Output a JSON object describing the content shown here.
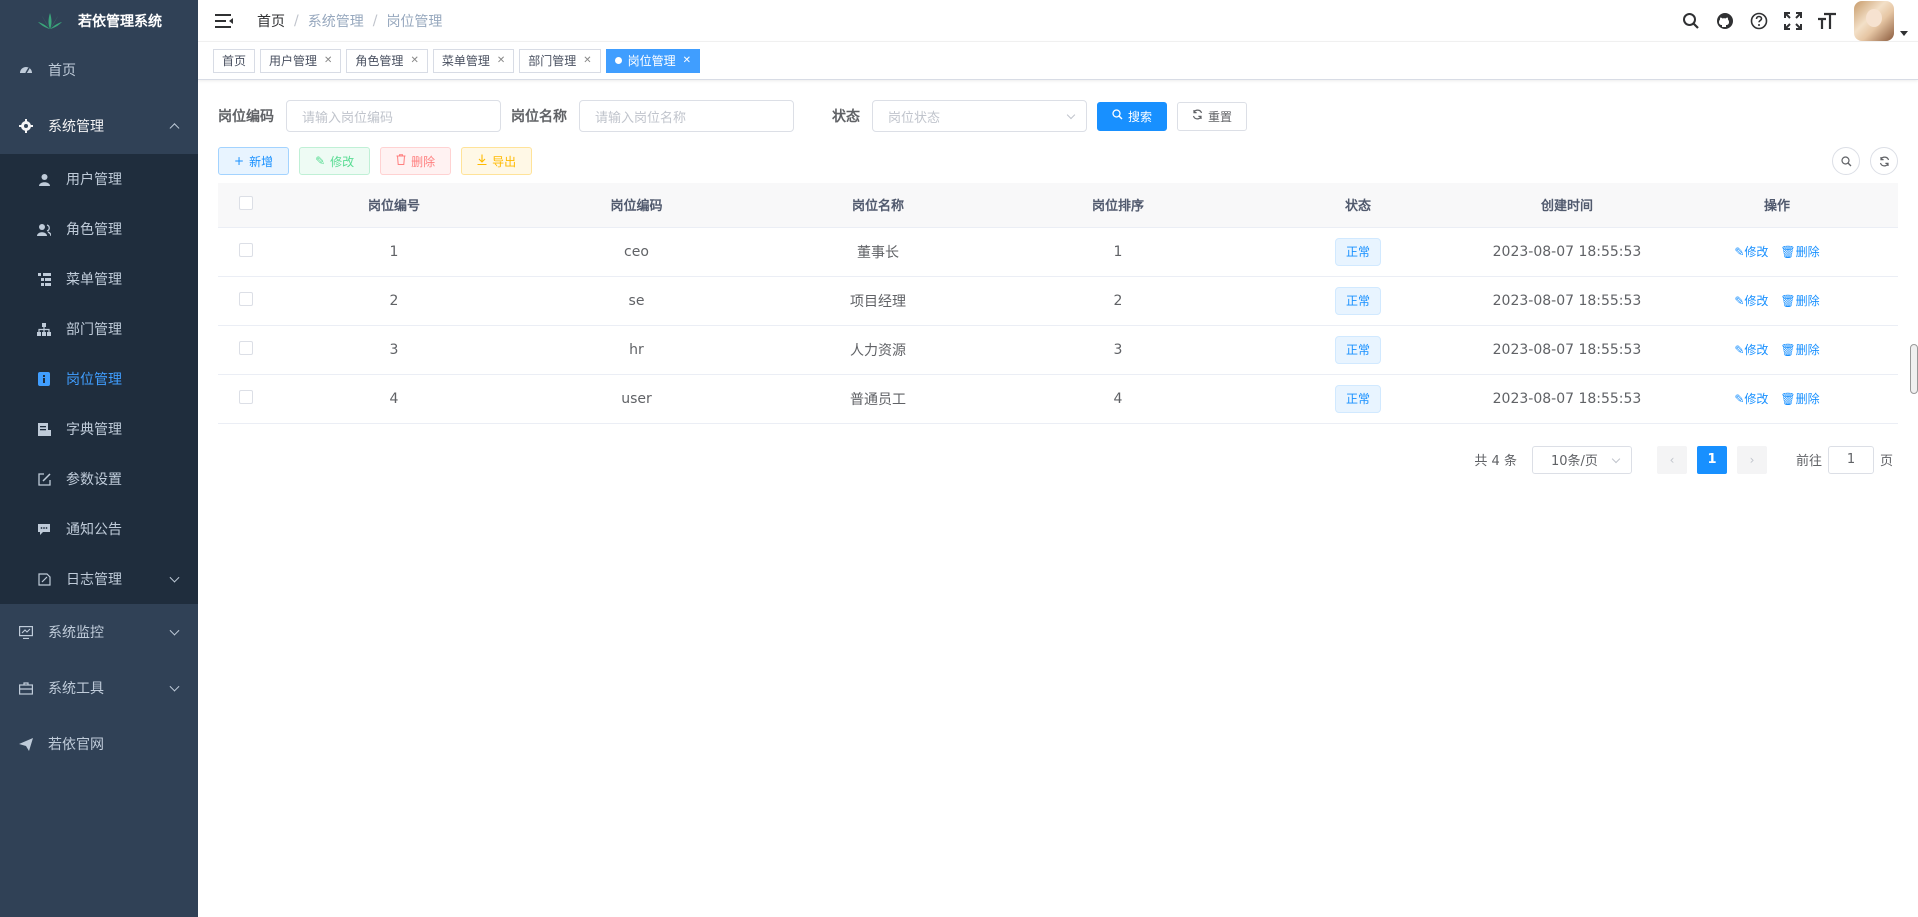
{
  "app": {
    "title": "若依管理系统"
  },
  "sidebar": {
    "items": [
      {
        "label": "首页",
        "icon": "dashboard-icon"
      },
      {
        "label": "系统管理",
        "icon": "gear-icon",
        "expanded": true,
        "children": [
          {
            "label": "用户管理",
            "icon": "user-icon"
          },
          {
            "label": "角色管理",
            "icon": "peoples-icon"
          },
          {
            "label": "菜单管理",
            "icon": "tree-table-icon"
          },
          {
            "label": "部门管理",
            "icon": "tree-icon"
          },
          {
            "label": "岗位管理",
            "icon": "post-icon",
            "active": true
          },
          {
            "label": "字典管理",
            "icon": "dict-icon"
          },
          {
            "label": "参数设置",
            "icon": "edit-icon"
          },
          {
            "label": "通知公告",
            "icon": "message-icon"
          },
          {
            "label": "日志管理",
            "icon": "log-icon",
            "collapsed": true
          }
        ]
      },
      {
        "label": "系统监控",
        "icon": "monitor-icon"
      },
      {
        "label": "系统工具",
        "icon": "tool-icon"
      },
      {
        "label": "若依官网",
        "icon": "guide-icon"
      }
    ]
  },
  "breadcrumb": [
    "首页",
    "系统管理",
    "岗位管理"
  ],
  "tags": [
    {
      "label": "首页",
      "closable": false
    },
    {
      "label": "用户管理",
      "closable": true
    },
    {
      "label": "角色管理",
      "closable": true
    },
    {
      "label": "菜单管理",
      "closable": true
    },
    {
      "label": "部门管理",
      "closable": true
    },
    {
      "label": "岗位管理",
      "closable": true,
      "active": true
    }
  ],
  "search_form": {
    "post_code_label": "岗位编码",
    "post_code_placeholder": "请输入岗位编码",
    "post_name_label": "岗位名称",
    "post_name_placeholder": "请输入岗位名称",
    "status_label": "状态",
    "status_placeholder": "岗位状态",
    "search_label": "搜索",
    "reset_label": "重置"
  },
  "toolbar": {
    "add": "新增",
    "edit": "修改",
    "delete": "删除",
    "export": "导出"
  },
  "table": {
    "headers": [
      "岗位编号",
      "岗位编码",
      "岗位名称",
      "岗位排序",
      "状态",
      "创建时间",
      "操作"
    ],
    "rows": [
      {
        "id": "1",
        "code": "ceo",
        "name": "董事长",
        "sort": "1",
        "status": "正常",
        "created": "2023-08-07 18:55:53"
      },
      {
        "id": "2",
        "code": "se",
        "name": "项目经理",
        "sort": "2",
        "status": "正常",
        "created": "2023-08-07 18:55:53"
      },
      {
        "id": "3",
        "code": "hr",
        "name": "人力资源",
        "sort": "3",
        "status": "正常",
        "created": "2023-08-07 18:55:53"
      },
      {
        "id": "4",
        "code": "user",
        "name": "普通员工",
        "sort": "4",
        "status": "正常",
        "created": "2023-08-07 18:55:53"
      }
    ],
    "op_edit": "修改",
    "op_delete": "删除"
  },
  "pagination": {
    "total_text": "共 4 条",
    "page_size": "10条/页",
    "current_page": "1",
    "goto_label": "前往",
    "goto_value": "1",
    "page_suffix": "页"
  },
  "colors": {
    "sidebar_bg": "#304156",
    "submenu_bg": "#1f2d3d",
    "primary": "#1890ff"
  }
}
